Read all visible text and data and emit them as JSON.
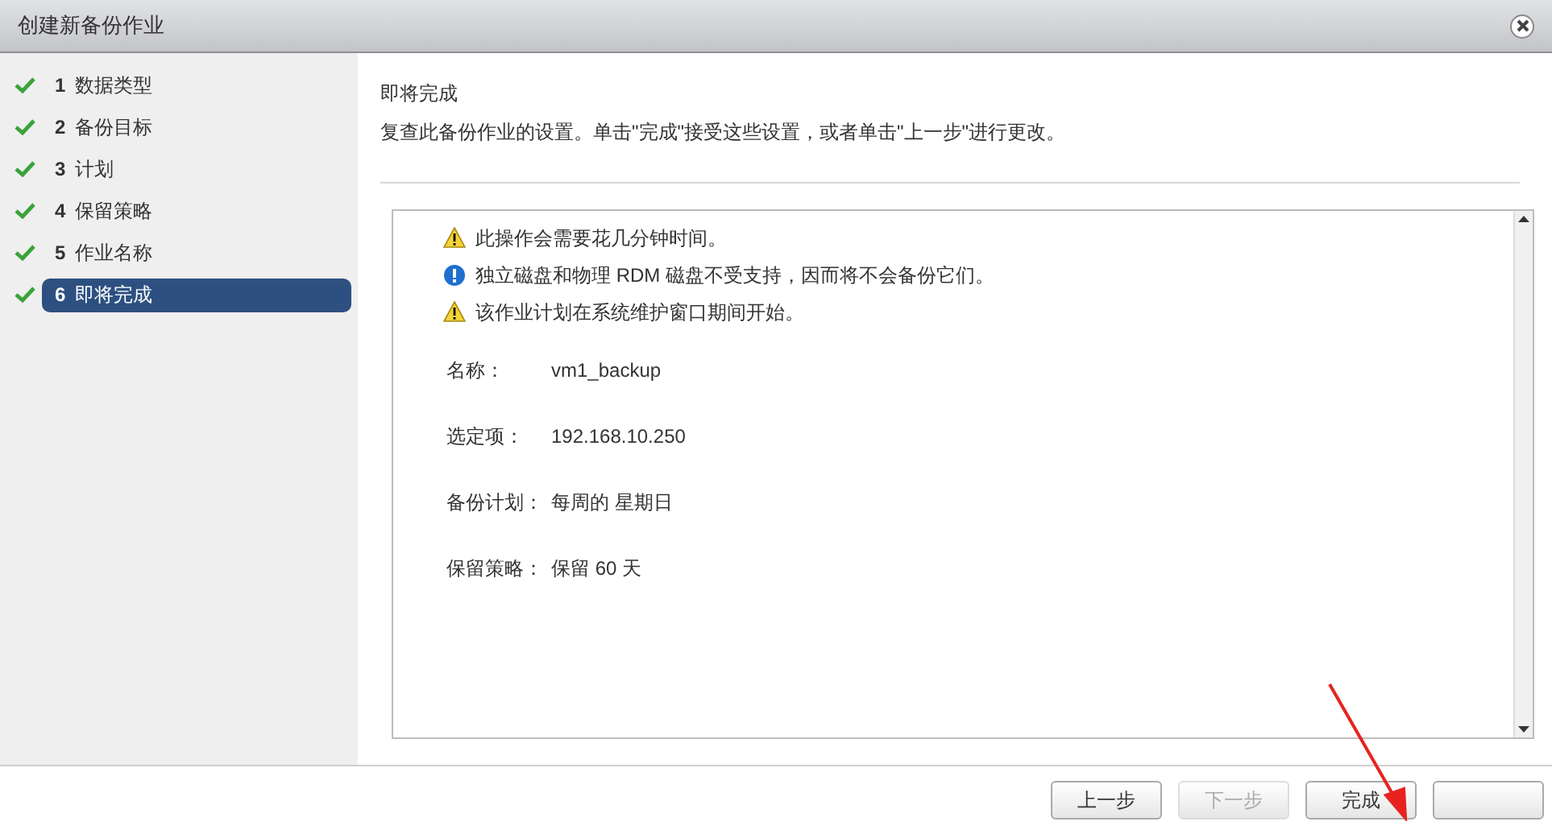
{
  "window": {
    "title": "创建新备份作业"
  },
  "steps": [
    {
      "number": "1",
      "label": "数据类型",
      "done": true,
      "selected": false
    },
    {
      "number": "2",
      "label": "备份目标",
      "done": true,
      "selected": false
    },
    {
      "number": "3",
      "label": "计划",
      "done": true,
      "selected": false
    },
    {
      "number": "4",
      "label": "保留策略",
      "done": true,
      "selected": false
    },
    {
      "number": "5",
      "label": "作业名称",
      "done": true,
      "selected": false
    },
    {
      "number": "6",
      "label": "即将完成",
      "done": true,
      "selected": true
    }
  ],
  "page": {
    "heading": "即将完成",
    "description": "复查此备份作业的设置。单击\"完成\"接受这些设置，或者单击\"上一步\"进行更改。"
  },
  "messages": [
    {
      "kind": "warning",
      "text": "此操作会需要花几分钟时间。"
    },
    {
      "kind": "info",
      "text": "独立磁盘和物理 RDM 磁盘不受支持，因而将不会备份它们。"
    },
    {
      "kind": "warning",
      "text": "该作业计划在系统维护窗口期间开始。"
    }
  ],
  "summary": [
    {
      "label": "名称：",
      "value": "vm1_backup"
    },
    {
      "label": "选定项：",
      "value": "192.168.10.250"
    },
    {
      "label": "备份计划：",
      "value": "每周的 星期日"
    },
    {
      "label": "保留策略：",
      "value": "保留 60 天"
    }
  ],
  "buttons": [
    {
      "label": "上一步",
      "disabled": false
    },
    {
      "label": "下一步",
      "disabled": true
    },
    {
      "label": "完成",
      "disabled": false
    },
    {
      "disabled": false
    }
  ]
}
